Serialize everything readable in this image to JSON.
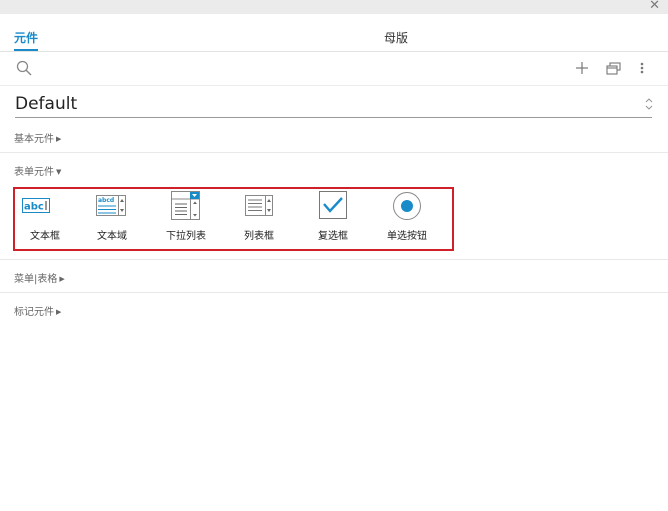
{
  "window": {
    "close_icon": "close-icon"
  },
  "tabs": [
    {
      "label": "元件",
      "active": true
    },
    {
      "label": "母版",
      "active": false
    }
  ],
  "toolbar": {
    "search_icon": "search-icon",
    "add_icon": "plus-icon",
    "duplicate_icon": "copy-windows-icon",
    "more_icon": "more-vertical-icon"
  },
  "library": {
    "selected": "Default"
  },
  "sections": [
    {
      "label": "基本元件",
      "expanded": false
    },
    {
      "label": "表单元件",
      "expanded": true
    },
    {
      "label": "菜单|表格",
      "expanded": false
    },
    {
      "label": "标记元件",
      "expanded": false
    }
  ],
  "form_widgets": [
    {
      "label": "文本框",
      "icon": "text-field-icon"
    },
    {
      "label": "文本域",
      "icon": "text-area-icon"
    },
    {
      "label": "下拉列表",
      "icon": "droplist-icon"
    },
    {
      "label": "列表框",
      "icon": "list-box-icon"
    },
    {
      "label": "复选框",
      "icon": "checkbox-icon"
    },
    {
      "label": "单选按钮",
      "icon": "radio-button-icon"
    }
  ],
  "colors": {
    "accent": "#1a8bc9",
    "highlight_border": "#d0212a"
  }
}
